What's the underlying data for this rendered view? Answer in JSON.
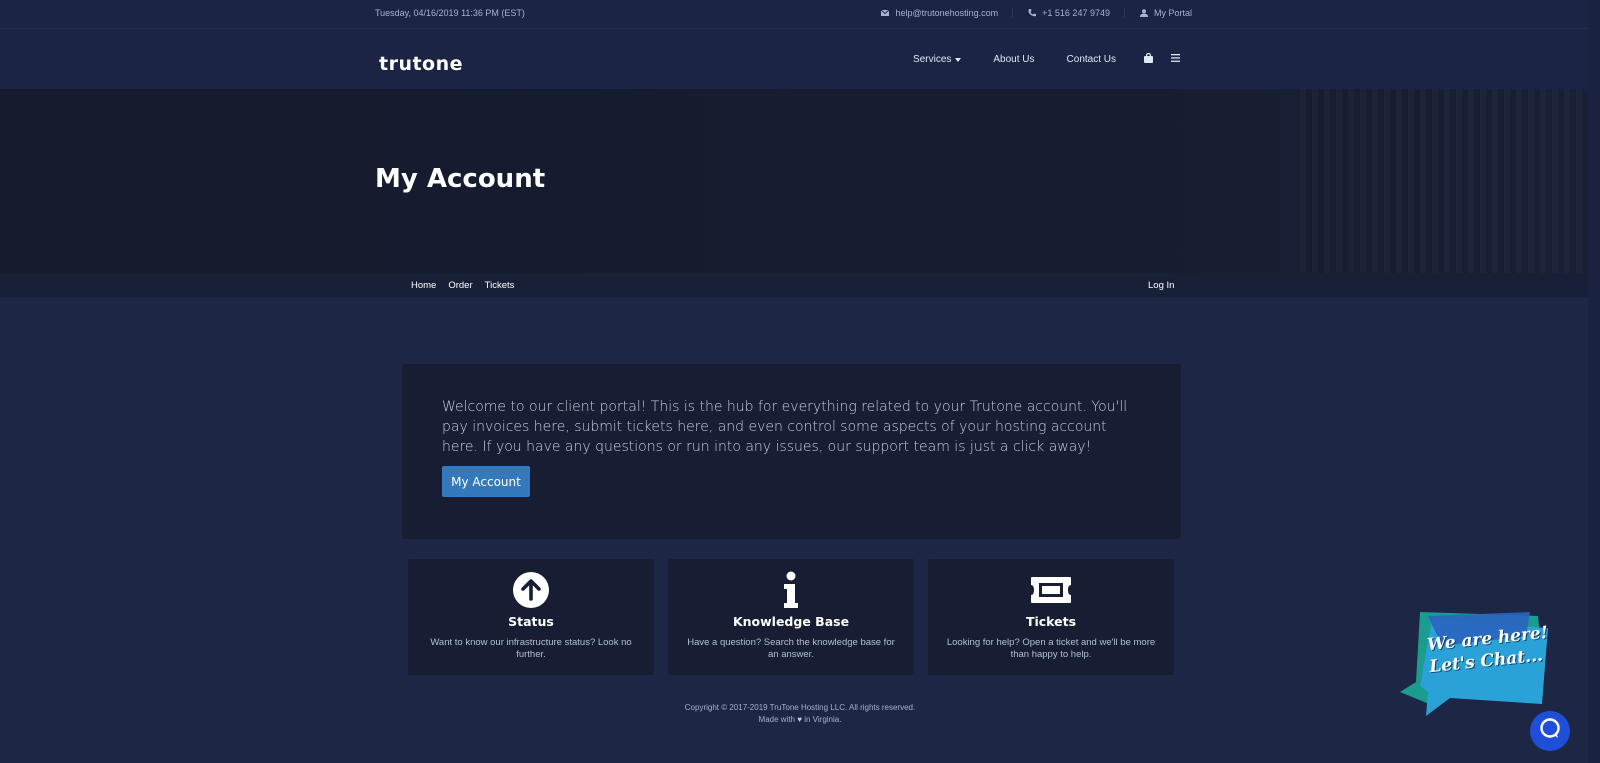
{
  "topbar": {
    "date": "Tuesday, 04/16/2019 11:36 PM (EST)",
    "email": "help@trutonehosting.com",
    "phone": "+1 516 247 9749",
    "portal": "My Portal"
  },
  "header": {
    "logo": "trutone",
    "nav": {
      "services": "Services",
      "about": "About Us",
      "contact": "Contact Us"
    }
  },
  "banner": {
    "title": "My Account"
  },
  "subnav": {
    "home": "Home",
    "order": "Order",
    "tickets": "Tickets",
    "login": "Log In"
  },
  "welcome": {
    "text": "Welcome to our client portal! This is the hub for everything related to your Trutone account. You'll pay invoices here, submit tickets here, and even control some aspects of your hosting account here. If you have any questions or run into any issues, our support team is just a click away!",
    "button": "My Account"
  },
  "features": [
    {
      "title": "Status",
      "desc": "Want to know our infrastructure status? Look no further.",
      "icon": "arrow-up-circle-icon"
    },
    {
      "title": "Knowledge Base",
      "desc": "Have a question? Search the knowledge base for an answer.",
      "icon": "info-icon"
    },
    {
      "title": "Tickets",
      "desc": "Looking for help? Open a ticket and we'll be more than happy to help.",
      "icon": "ticket-icon"
    }
  ],
  "footer": {
    "copyright": "Copyright © 2017-2019 TruTone Hosting LLC. All rights reserved.",
    "made_prefix": "Made with",
    "made_suffix": "in Virginia."
  },
  "chat": {
    "line1": "We are here!",
    "line2": "Let's Chat..."
  },
  "colors": {
    "background": "#1d2645",
    "card": "#171d33",
    "button": "#3579bd",
    "chat": "#1e4fd6"
  }
}
